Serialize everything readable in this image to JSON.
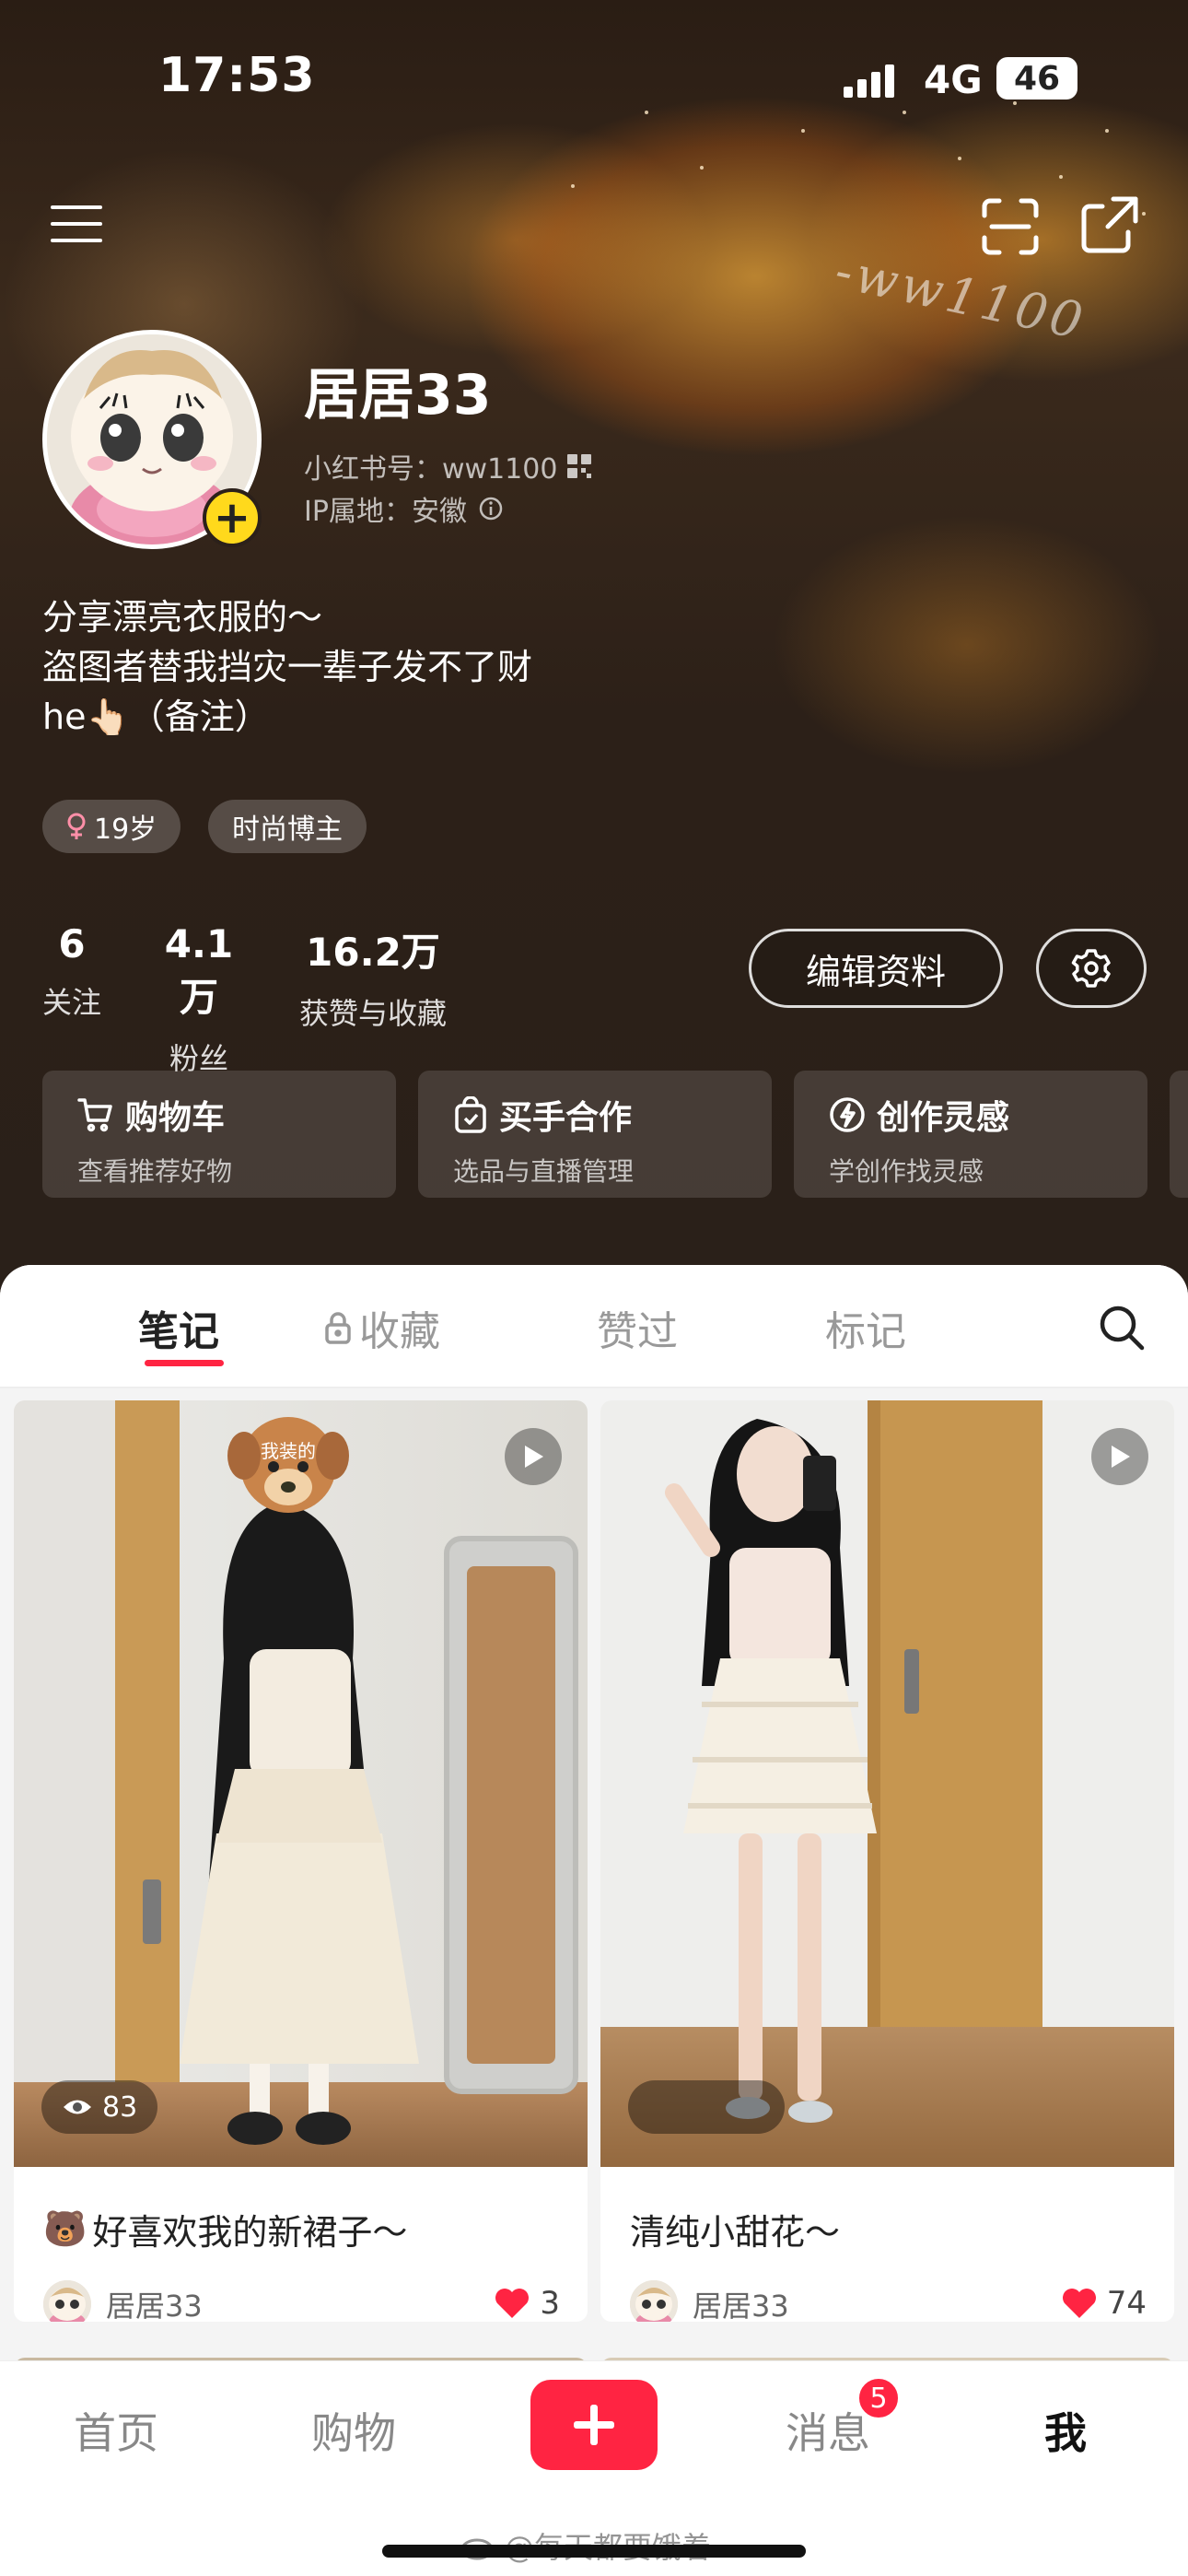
{
  "status_bar": {
    "time": "17:53",
    "network": "4G",
    "battery": "46"
  },
  "header": {
    "bg_watermark": "-ww1100"
  },
  "profile": {
    "name": "居居33",
    "xhs_id": "小红书号：ww1100",
    "ip_location": "IP属地：安徽",
    "bio": [
      "分享漂亮衣服的～",
      "盗图者替我挡灾一辈子发不了财",
      "he👆🏻（备注）"
    ],
    "tags": {
      "age": "19岁",
      "role": "时尚博主"
    },
    "stats": [
      {
        "num": "6",
        "label": "关注"
      },
      {
        "num": "4.1万",
        "label": "粉丝"
      },
      {
        "num": "16.2万",
        "label": "获赞与收藏"
      }
    ],
    "edit_label": "编辑资料"
  },
  "tools": [
    {
      "title": "购物车",
      "sub": "查看推荐好物"
    },
    {
      "title": "买手合作",
      "sub": "选品与直播管理"
    },
    {
      "title": "创作灵感",
      "sub": "学创作找灵感"
    }
  ],
  "tabs": [
    "笔记",
    "收藏",
    "赞过",
    "标记"
  ],
  "notes": [
    {
      "title": "好喜欢我的新裙子～",
      "title_emoji": "🐻",
      "author": "居居33",
      "likes": "3",
      "views": "83",
      "sticker": "我装的"
    },
    {
      "title": "清纯小甜花～",
      "author": "居居33",
      "likes": "74"
    }
  ],
  "bottom_nav": {
    "home": "首页",
    "shop": "购物",
    "messages": "消息",
    "me": "我",
    "msg_badge": "5"
  },
  "footer_watermark": "@每天都要饿着",
  "colors": {
    "accent": "#ff2442",
    "badge_yellow": "#ffd91c"
  }
}
